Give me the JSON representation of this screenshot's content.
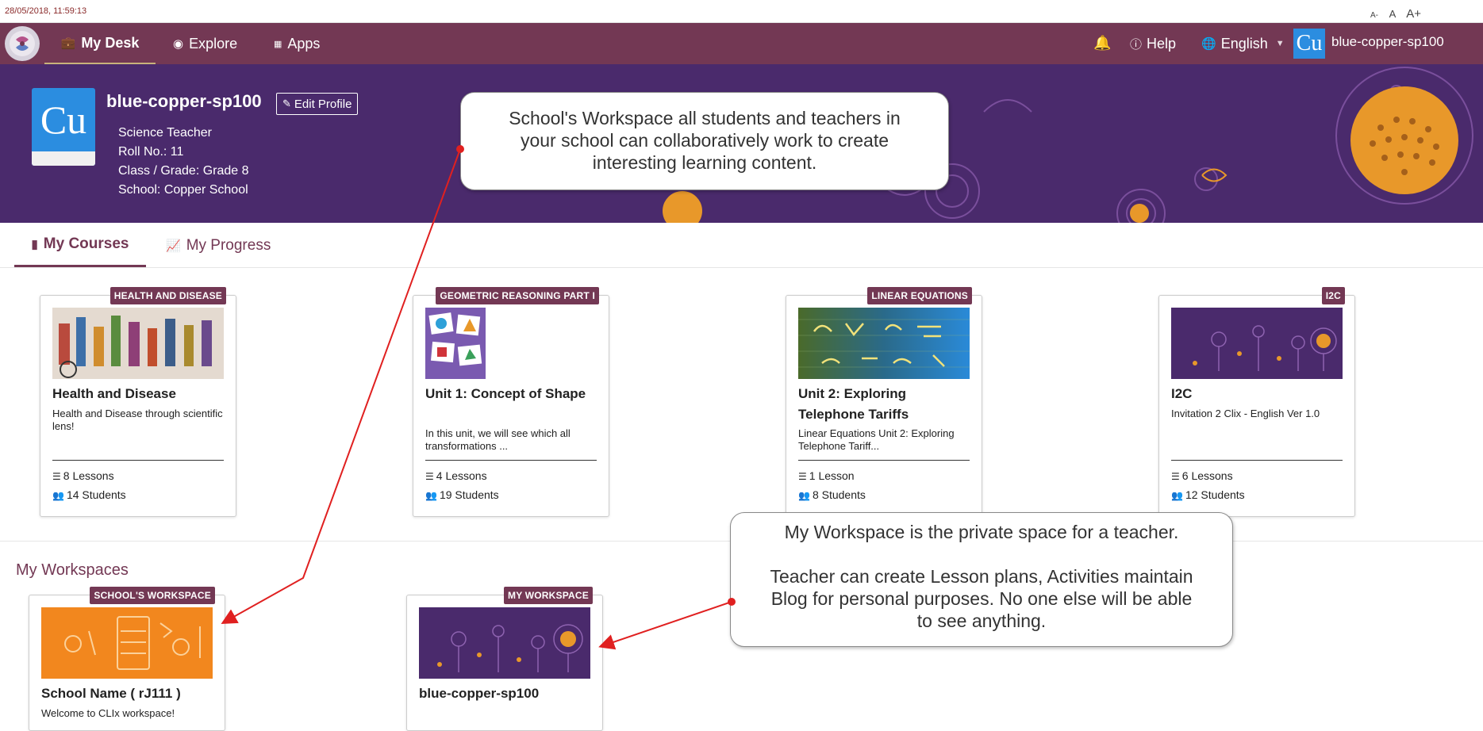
{
  "topbar": {
    "timestamp": "28/05/2018, 11:59:13",
    "font_small": "A-",
    "font_normal": "A",
    "font_large": "A+"
  },
  "nav": {
    "my_desk": "My Desk",
    "explore": "Explore",
    "apps": "Apps",
    "help": "Help",
    "language": "English",
    "avatar_text": "Cu",
    "username": "blue-copper-sp100"
  },
  "profile": {
    "avatar_text": "Cu",
    "name": "blue-copper-sp100",
    "edit_label": "Edit Profile",
    "role": "Science Teacher",
    "roll": "Roll No.: 11",
    "grade": "Class / Grade: Grade 8",
    "school": "School: Copper School"
  },
  "tabs": {
    "my_courses": "My Courses",
    "my_progress": "My Progress"
  },
  "courses": [
    {
      "tag": "HEALTH AND DISEASE",
      "title": "Health and Disease",
      "desc": "Health and Disease through scientific lens!",
      "lessons": "8 Lessons",
      "students": "14 Students"
    },
    {
      "tag": "GEOMETRIC REASONING PART I",
      "title": "Unit 1: Concept of Shape",
      "desc": "In this unit, we will see which all transformations ...",
      "lessons": "4 Lessons",
      "students": "19 Students"
    },
    {
      "tag": "LINEAR EQUATIONS",
      "title": "Unit 2: Exploring Telephone Tariffs",
      "desc": "Linear Equations Unit 2: Exploring Telephone Tariff...",
      "lessons": "1 Lesson",
      "students": "8 Students"
    },
    {
      "tag": "I2C",
      "title": "I2C",
      "desc": "Invitation 2 Clix -  English Ver 1.0",
      "lessons": "6 Lessons",
      "students": "12 Students"
    }
  ],
  "workspaces": {
    "heading": "My Workspaces",
    "items": [
      {
        "tag": "SCHOOL'S WORKSPACE",
        "title": "School Name ( rJ111 )",
        "desc": "Welcome to CLIx workspace!"
      },
      {
        "tag": "MY WORKSPACE",
        "title": "blue-copper-sp100",
        "desc": ""
      }
    ]
  },
  "callouts": {
    "school_line1": "School's Workspace all students and teachers in",
    "school_line2": "your school can collaboratively work to create",
    "school_line3": "interesting learning content.",
    "mine_line1": "My Workspace is the private space for a teacher.",
    "mine_line2": "Teacher can create Lesson plans, Activities maintain",
    "mine_line3": "Blog for personal purposes. No one else will be able",
    "mine_line4": "to see anything."
  },
  "colors": {
    "brand": "#733854",
    "banner": "#4a2a6c",
    "avatar": "#2b8de0",
    "arrow": "#e02020"
  }
}
